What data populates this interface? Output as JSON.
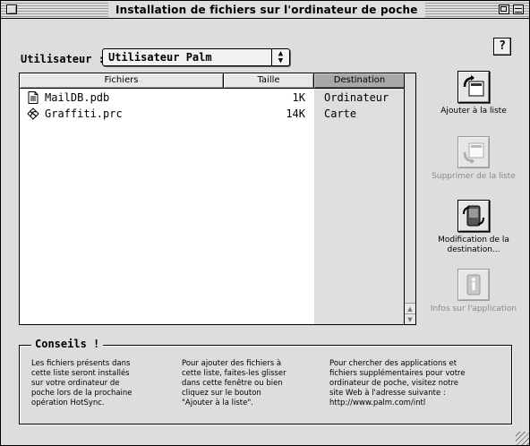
{
  "window": {
    "title": "Installation de fichiers sur l'ordinateur de poche"
  },
  "help": {
    "label": "?"
  },
  "user": {
    "label": "Utilisateur :",
    "selected": "Utilisateur Palm"
  },
  "table": {
    "columns": {
      "files": "Fichiers",
      "size": "Taille",
      "destination": "Destination"
    },
    "sorted_column": "destination",
    "rows": [
      {
        "icon": "database-file-icon",
        "name": "MailDB.pdb",
        "size": "1K",
        "destination": "Ordinateur"
      },
      {
        "icon": "graffiti-app-icon",
        "name": "Graffiti.prc",
        "size": "14K",
        "destination": "Carte"
      }
    ]
  },
  "actions": {
    "add": {
      "label": "Ajouter à la liste",
      "enabled": true,
      "icon": "add-to-list-icon"
    },
    "remove": {
      "label": "Supprimer de la liste",
      "enabled": false,
      "icon": "remove-from-list-icon"
    },
    "change_dest": {
      "label": "Modification de la destination...",
      "enabled": true,
      "icon": "change-destination-icon"
    },
    "info": {
      "label": "Infos sur l'application",
      "enabled": false,
      "icon": "info-icon"
    }
  },
  "tips": {
    "title": "Conseils !",
    "items": [
      "Les fichiers présents dans\ncette liste seront installés\nsur votre ordinateur de\npoche lors de la prochaine\nopération HotSync.",
      "Pour ajouter des fichiers à\ncette liste, faites-les glisser\ndans cette fenêtre ou bien\ncliquez sur le bouton\n\"Ajouter à la liste\".",
      "Pour chercher des applications et\nfichiers supplémentaires pour votre\nordinateur de poche, visitez notre\nsite Web à l'adresse suivante :\nhttp://www.palm.com/intl"
    ]
  },
  "colors": {
    "window_bg": "#dddddd",
    "list_bg": "#ffffff",
    "sorted_header": "#a8a8a8",
    "sorted_column_band": "#dedede",
    "disabled_text": "#8a8a8a"
  }
}
